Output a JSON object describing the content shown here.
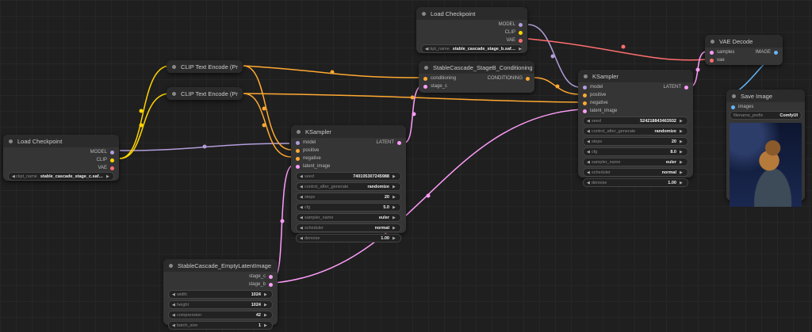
{
  "colors": {
    "model": "#b39ddb",
    "clip": "#ffd600",
    "vae": "#ff6e6e",
    "conditioning": "#ffa931",
    "latent": "#ff9cf9",
    "image": "#64b5f6"
  },
  "nodes": {
    "load_checkpoint_c": {
      "title": "Load Checkpoint",
      "out_model": "MODEL",
      "out_clip": "CLIP",
      "out_vae": "VAE",
      "ckpt_label": "ckpt_name",
      "ckpt_value": "stable_cascade_stage_c.saf…"
    },
    "clip_pos": {
      "title": "CLIP Text Encode (Pr"
    },
    "clip_neg": {
      "title": "CLIP Text Encode (Pr"
    },
    "load_checkpoint_b": {
      "title": "Load Checkpoint",
      "out_model": "MODEL",
      "out_clip": "CLIP",
      "out_vae": "VAE",
      "ckpt_label": "ckpt_name",
      "ckpt_value": "stable_cascade_stage_b.saf…"
    },
    "stage_b_cond": {
      "title": "StableCascade_StageB_Conditioning",
      "in_cond": "conditioning",
      "in_stage_c": "stage_c",
      "out_cond": "CONDITIONING"
    },
    "ksampler_c": {
      "title": "KSampler",
      "in_model": "model",
      "in_positive": "positive",
      "in_negative": "negative",
      "in_latent": "latent_image",
      "out_latent": "LATENT",
      "widgets": [
        {
          "label": "seed",
          "value": "740105307245988"
        },
        {
          "label": "control_after_generate",
          "value": "randomize"
        },
        {
          "label": "steps",
          "value": "20"
        },
        {
          "label": "cfg",
          "value": "5.0"
        },
        {
          "label": "sampler_name",
          "value": "euler"
        },
        {
          "label": "scheduler",
          "value": "normal"
        },
        {
          "label": "denoise",
          "value": "1.00"
        }
      ]
    },
    "ksampler_b": {
      "title": "KSampler",
      "in_model": "model",
      "in_positive": "positive",
      "in_negative": "negative",
      "in_latent": "latent_image",
      "out_latent": "LATENT",
      "widgets": [
        {
          "label": "seed",
          "value": "524218843463932"
        },
        {
          "label": "control_after_generate",
          "value": "randomize"
        },
        {
          "label": "steps",
          "value": "20"
        },
        {
          "label": "cfg",
          "value": "8.0"
        },
        {
          "label": "sampler_name",
          "value": "euler"
        },
        {
          "label": "scheduler",
          "value": "normal"
        },
        {
          "label": "denoise",
          "value": "1.00"
        }
      ]
    },
    "empty_latent": {
      "title": "StableCascade_EmptyLatentImage",
      "out_stage_c": "stage_c",
      "out_stage_b": "stage_b",
      "widgets": [
        {
          "label": "width",
          "value": "1024"
        },
        {
          "label": "height",
          "value": "1024"
        },
        {
          "label": "compression",
          "value": "42"
        },
        {
          "label": "batch_size",
          "value": "1"
        }
      ]
    },
    "vae_decode": {
      "title": "VAE Decode",
      "in_samples": "samples",
      "in_vae": "vae",
      "out_image": "IMAGE"
    },
    "save_image": {
      "title": "Save Image",
      "in_images": "images",
      "prefix_label": "filename_prefix",
      "prefix_value": "ComfyUI"
    }
  }
}
